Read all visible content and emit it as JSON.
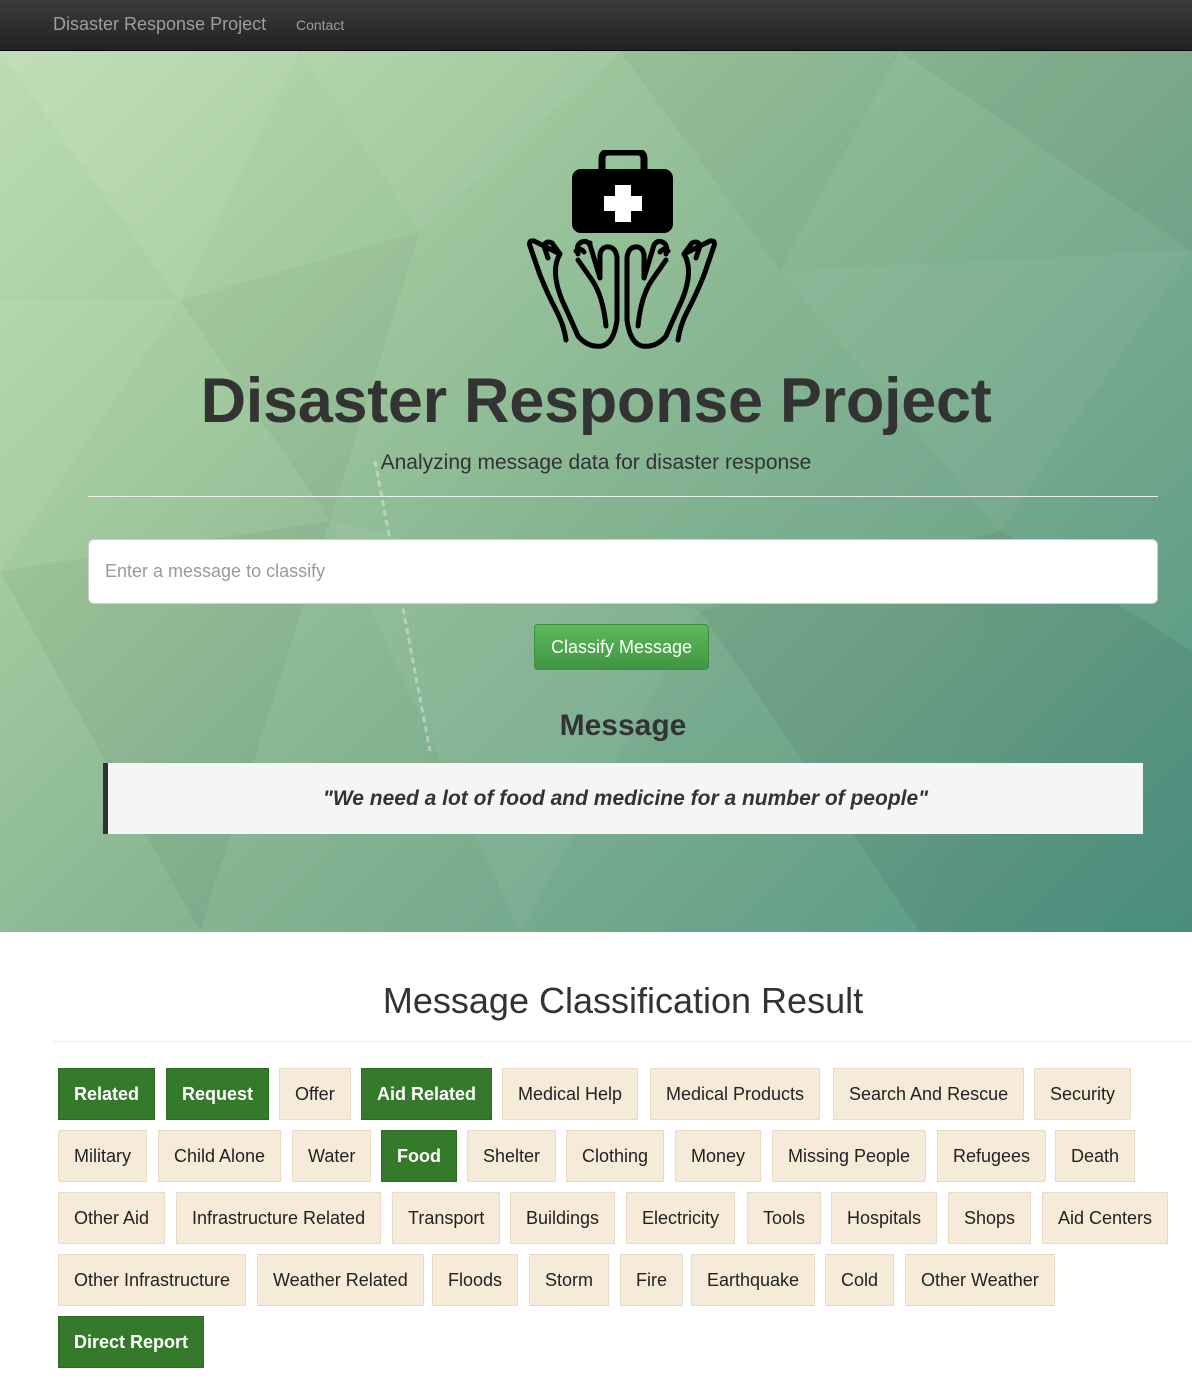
{
  "navbar": {
    "brand": "Disaster Response Project",
    "contact": "Contact"
  },
  "hero": {
    "logo_icon": "medical-kit-hands-icon",
    "title": "Disaster Response Project",
    "subtitle": "Analyzing message data for disaster response",
    "input_placeholder": "Enter a message to classify",
    "classify_button": "Classify Message",
    "message_heading": "Message",
    "message_text": "\"We need a lot of food and medicine for a number of people\""
  },
  "results": {
    "title": "Message Classification Result",
    "colors": {
      "active": "#357a2a",
      "inactive": "#f6ead8"
    },
    "categories": [
      {
        "label": "Related",
        "active": true
      },
      {
        "label": "Request",
        "active": true
      },
      {
        "label": "Offer",
        "active": false
      },
      {
        "label": "Aid Related",
        "active": true
      },
      {
        "label": "Medical Help",
        "active": false
      },
      {
        "label": "Medical Products",
        "active": false
      },
      {
        "label": "Search And Rescue",
        "active": false
      },
      {
        "label": "Security",
        "active": false
      },
      {
        "label": "Military",
        "active": false
      },
      {
        "label": "Child Alone",
        "active": false
      },
      {
        "label": "Water",
        "active": false
      },
      {
        "label": "Food",
        "active": true
      },
      {
        "label": "Shelter",
        "active": false
      },
      {
        "label": "Clothing",
        "active": false
      },
      {
        "label": "Money",
        "active": false
      },
      {
        "label": "Missing People",
        "active": false
      },
      {
        "label": "Refugees",
        "active": false
      },
      {
        "label": "Death",
        "active": false
      },
      {
        "label": "Other Aid",
        "active": false
      },
      {
        "label": "Infrastructure Related",
        "active": false
      },
      {
        "label": "Transport",
        "active": false
      },
      {
        "label": "Buildings",
        "active": false
      },
      {
        "label": "Electricity",
        "active": false
      },
      {
        "label": "Tools",
        "active": false
      },
      {
        "label": "Hospitals",
        "active": false
      },
      {
        "label": "Shops",
        "active": false
      },
      {
        "label": "Aid Centers",
        "active": false
      },
      {
        "label": "Other Infrastructure",
        "active": false
      },
      {
        "label": "Weather Related",
        "active": false
      },
      {
        "label": "Floods",
        "active": false
      },
      {
        "label": "Storm",
        "active": false
      },
      {
        "label": "Fire",
        "active": false
      },
      {
        "label": "Earthquake",
        "active": false
      },
      {
        "label": "Cold",
        "active": false
      },
      {
        "label": "Other Weather",
        "active": false
      },
      {
        "label": "Direct Report",
        "active": true
      }
    ]
  }
}
